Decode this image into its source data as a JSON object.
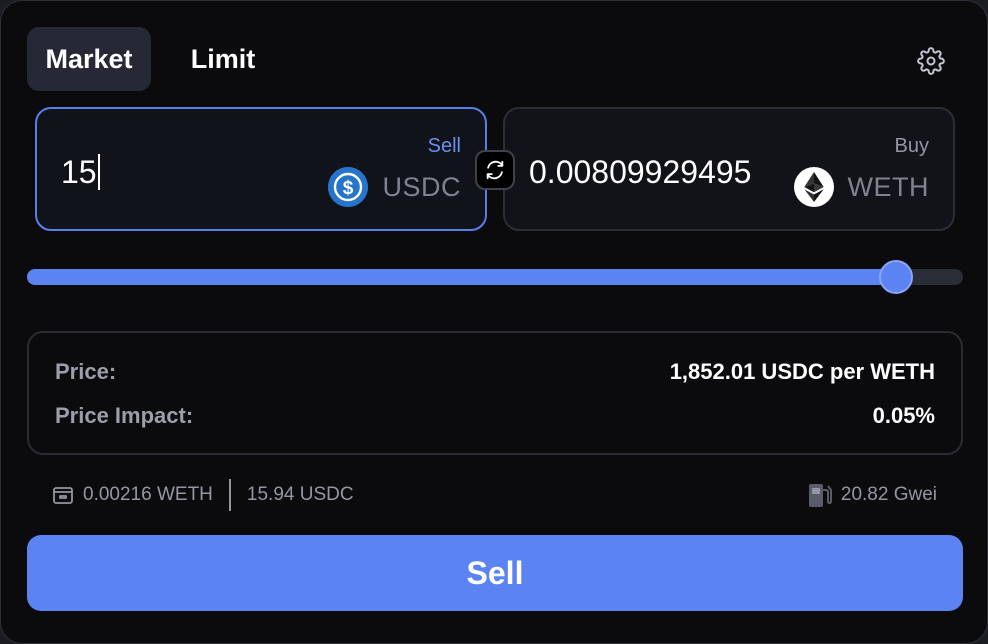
{
  "tabs": [
    {
      "label": "Market",
      "active": true
    },
    {
      "label": "Limit",
      "active": false
    }
  ],
  "settings_icon": "gear-icon",
  "sell": {
    "label": "Sell",
    "amount": "15",
    "token": "USDC",
    "token_icon": "usdc-icon",
    "token_color": "#2775ca"
  },
  "buy": {
    "label": "Buy",
    "amount": "0.00809929495",
    "token": "WETH",
    "token_icon": "eth-icon"
  },
  "swap_icon": "swap-arrows-icon",
  "slider": {
    "value_fraction": 0.928
  },
  "info": {
    "price_label": "Price:",
    "price_value": "1,852.01 USDC per WETH",
    "impact_label": "Price Impact:",
    "impact_value": "0.05%"
  },
  "balances": {
    "icon": "wallet-icon",
    "weth": "0.00216 WETH",
    "usdc": "15.94 USDC"
  },
  "gas": {
    "icon": "gas-pump-icon",
    "value": "20.82 Gwei"
  },
  "action_button": "Sell",
  "colors": {
    "accent": "#5c83f2",
    "background": "#0b0b0e",
    "panel": "#11131b"
  }
}
